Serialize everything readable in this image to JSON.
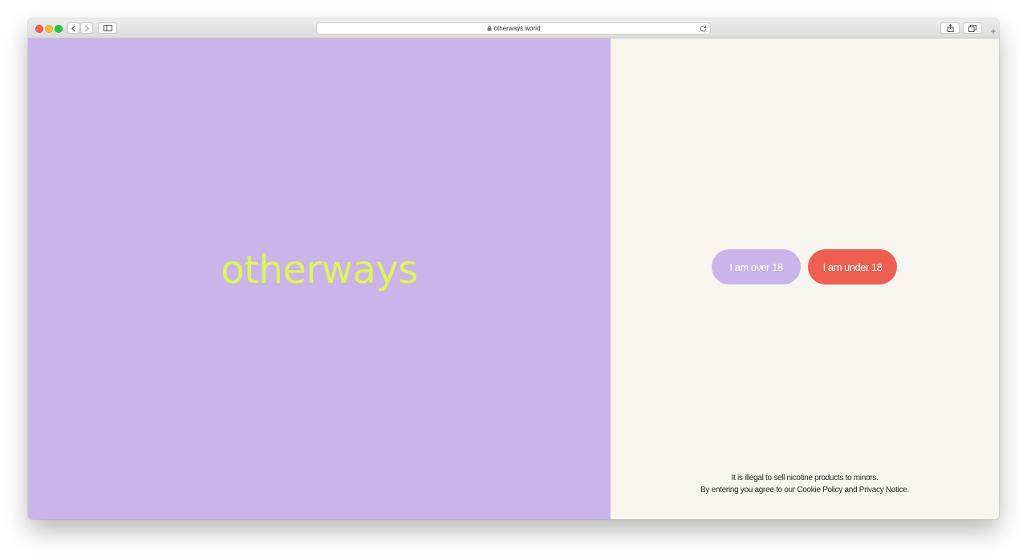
{
  "browser": {
    "url": "otherways.world",
    "icons": {
      "back": "chevron-left-icon",
      "forward": "chevron-right-icon",
      "sidebar": "sidebar-icon",
      "lock": "lock-icon",
      "reload": "reload-icon",
      "share": "share-icon",
      "tabs": "tabs-icon",
      "new_tab": "plus-icon"
    }
  },
  "brand": {
    "logo_text": "otherways",
    "colors": {
      "lilac": "#cab4ea",
      "lime": "#dff45a",
      "coral": "#ee5f52",
      "cream": "#f8f5ee"
    }
  },
  "age_gate": {
    "over_label": "I am over 18",
    "under_label": "I am under 18"
  },
  "notice": {
    "line1": "It is illegal to sell nicotine products to minors.",
    "line2": "By entering you agree to our Cookie Policy and Privacy Notice."
  }
}
